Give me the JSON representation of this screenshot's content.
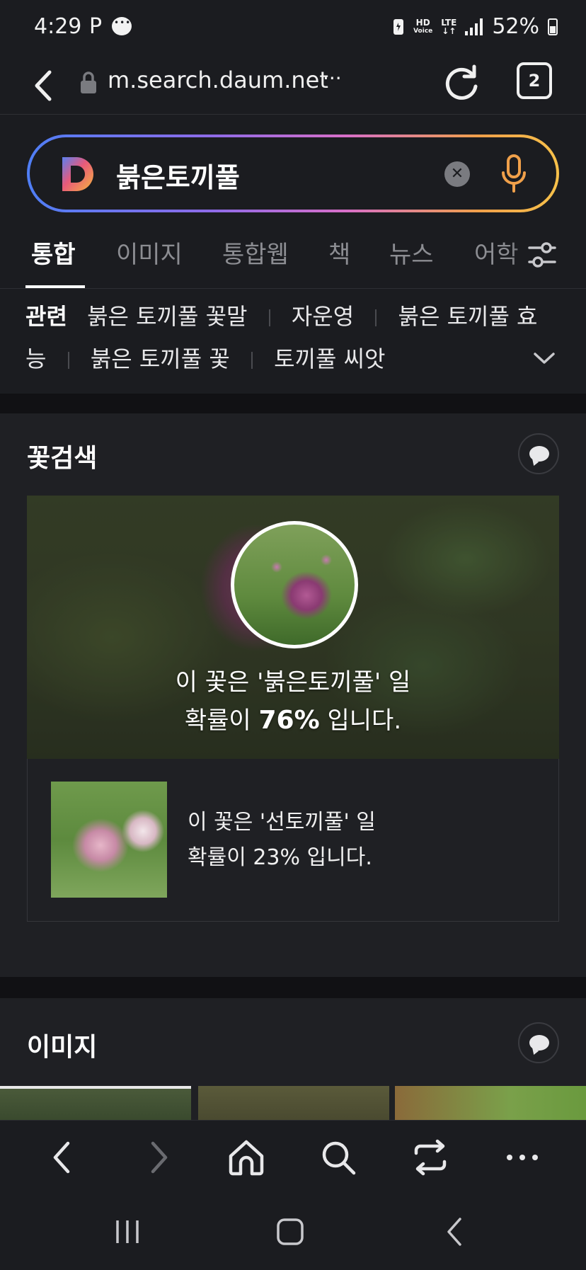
{
  "status": {
    "time": "4:29",
    "p": "P",
    "net_top": "HD",
    "net_bottom": "Voice",
    "lte_top": "LTE",
    "lte_bottom": "↓↑",
    "battery": "52%"
  },
  "url": {
    "text": "m.search.daum.net",
    "more": "···",
    "tab_count": "2"
  },
  "search": {
    "query": "붉은토끼풀"
  },
  "tabs": [
    "통합",
    "이미지",
    "통합웹",
    "책",
    "뉴스",
    "어학"
  ],
  "related": {
    "label": "관련",
    "items": [
      "붉은 토끼풀 꽃말",
      "자운영",
      "붉은 토끼풀 효",
      "능",
      "붉은 토끼풀 꽃",
      "토끼풀 씨앗"
    ]
  },
  "flower_search": {
    "title": "꽃검색",
    "main_line1": "이 꽃은 '붉은토끼풀' 일",
    "main_line2_pre": "확률이 ",
    "main_percent": "76%",
    "main_line2_post": " 입니다.",
    "alt_line1": "이 꽃은 '선토끼풀' 일",
    "alt_line2": "확률이 23% 입니다."
  },
  "images_section": {
    "title": "이미지"
  },
  "colors": {
    "background": "#1b1c20",
    "card": "#1f2024",
    "accent_mic": "#f0a04a"
  }
}
